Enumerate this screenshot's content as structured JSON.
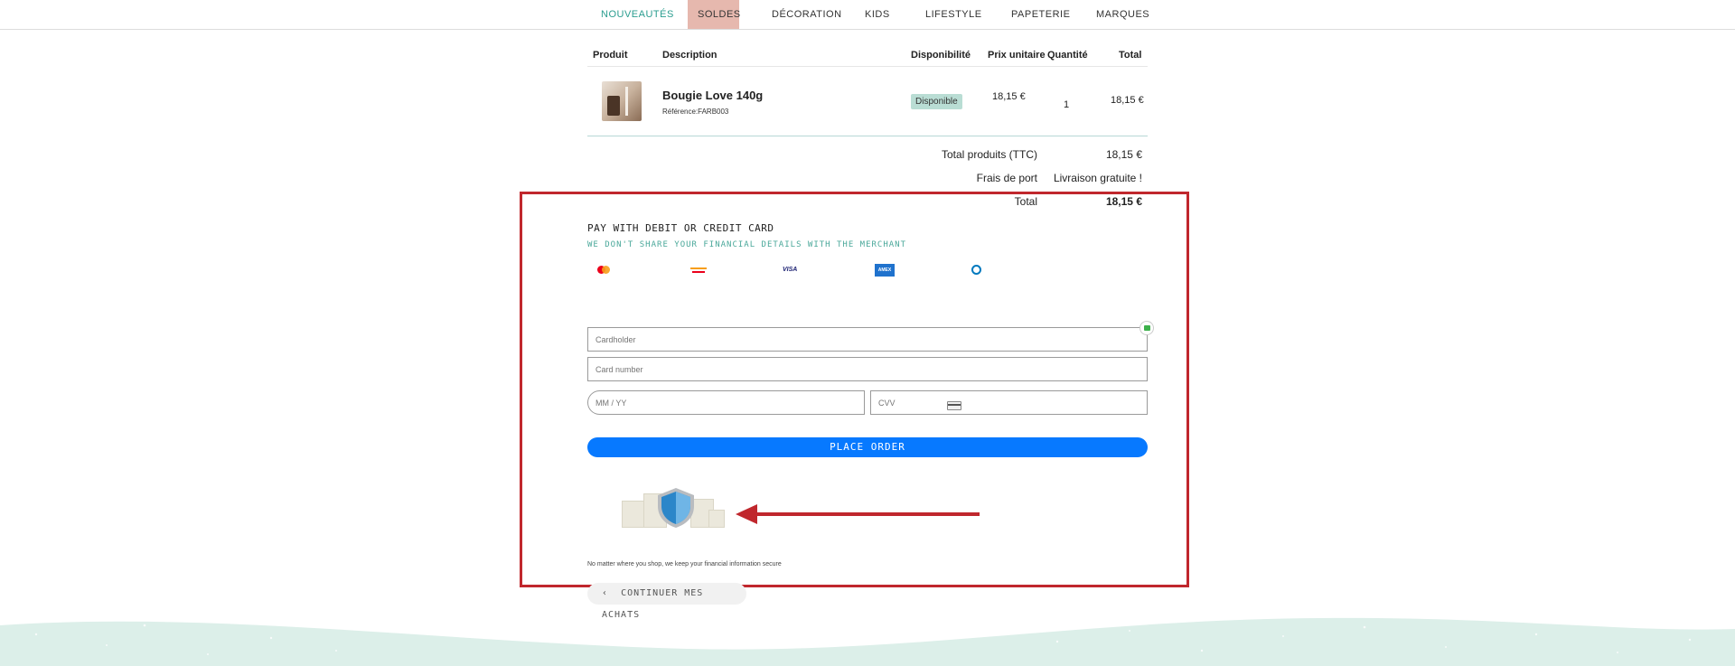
{
  "nav": {
    "items": [
      {
        "label": "NOUVEAUTÉS"
      },
      {
        "label": "SOLDES"
      },
      {
        "label": "DÉCORATION"
      },
      {
        "label": "KIDS"
      },
      {
        "label": "LIFESTYLE"
      },
      {
        "label": "PAPETERIE"
      },
      {
        "label": "MARQUES"
      }
    ]
  },
  "cart": {
    "headers": {
      "product": "Produit",
      "description": "Description",
      "availability": "Disponibilité",
      "unit_price": "Prix unitaire",
      "quantity": "Quantité",
      "total": "Total"
    },
    "items": [
      {
        "name": "Bougie Love 140g",
        "reference": "Référence:FARB003",
        "availability": "Disponible",
        "unit_price": "18,15 €",
        "quantity": "1",
        "total": "18,15 €"
      }
    ],
    "summary": {
      "products_label": "Total produits (TTC)",
      "products_value": "18,15 €",
      "shipping_label": "Frais de port",
      "shipping_value": "Livraison gratuite !",
      "total_label": "Total",
      "total_value": "18,15 €"
    }
  },
  "payment": {
    "title": "PAY WITH DEBIT OR CREDIT CARD",
    "subtitle": "WE DON'T SHARE YOUR FINANCIAL DETAILS WITH THE MERCHANT",
    "card_brands": [
      "mastercard-icon",
      "maestro-icon",
      "visa-icon",
      "amex-icon",
      "diners-icon"
    ],
    "fields": {
      "cardholder_placeholder": "Cardholder",
      "card_number_placeholder": "Card number",
      "expiry_placeholder": "MM / YY",
      "cvv_placeholder": "CVV"
    },
    "place_order_label": "PLACE ORDER",
    "secure_note": "No matter where you shop, we keep your financial information secure"
  },
  "continue_label": "CONTINUER MES ACHATS",
  "colors": {
    "accent_teal": "#2a9d8f",
    "sale_bg": "#e6b8ae",
    "primary_button": "#0779ff",
    "annotation_red": "#c0272d",
    "footer_mint": "#dcefe9"
  }
}
